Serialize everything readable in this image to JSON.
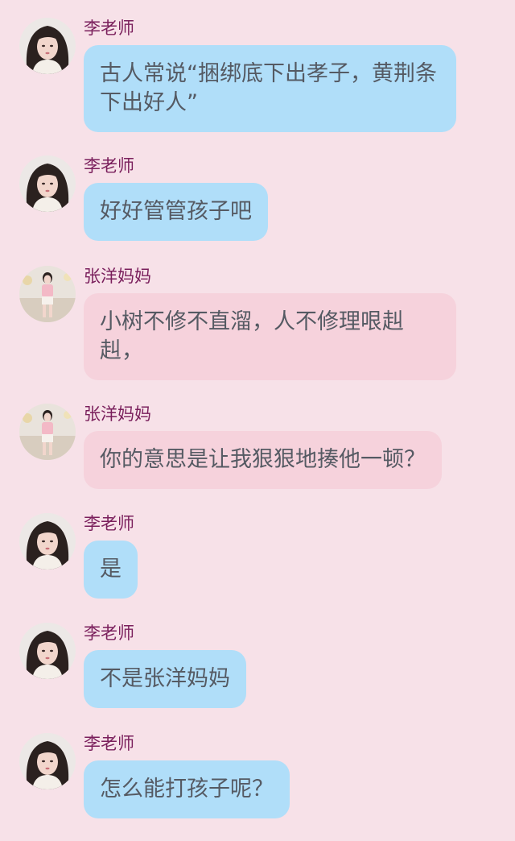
{
  "colors": {
    "background": "#f7e1e8",
    "sender_name": "#7a1f5c",
    "bubble_teacher": "#b0def9",
    "bubble_parent": "#f6d2dc",
    "message_text": "#555a63"
  },
  "senders": {
    "teacher": {
      "name": "李老师",
      "avatar_icon": "teacher-avatar"
    },
    "parent": {
      "name": "张洋妈妈",
      "avatar_icon": "parent-avatar"
    }
  },
  "messages": [
    {
      "sender": "李老师",
      "text": "古人常说“捆绑底下出孝子，黄荆条下出好人”"
    },
    {
      "sender": "李老师",
      "text": "好好管管孩子吧"
    },
    {
      "sender": "张洋妈妈",
      "text": "小树不修不直溜，人不修理哏赳赳，"
    },
    {
      "sender": "张洋妈妈",
      "text": "你的意思是让我狠狠地揍他一顿？"
    },
    {
      "sender": "李老师",
      "text": "是"
    },
    {
      "sender": "李老师",
      "text": "不是张洋妈妈"
    },
    {
      "sender": "李老师",
      "text": "怎么能打孩子呢？"
    }
  ]
}
